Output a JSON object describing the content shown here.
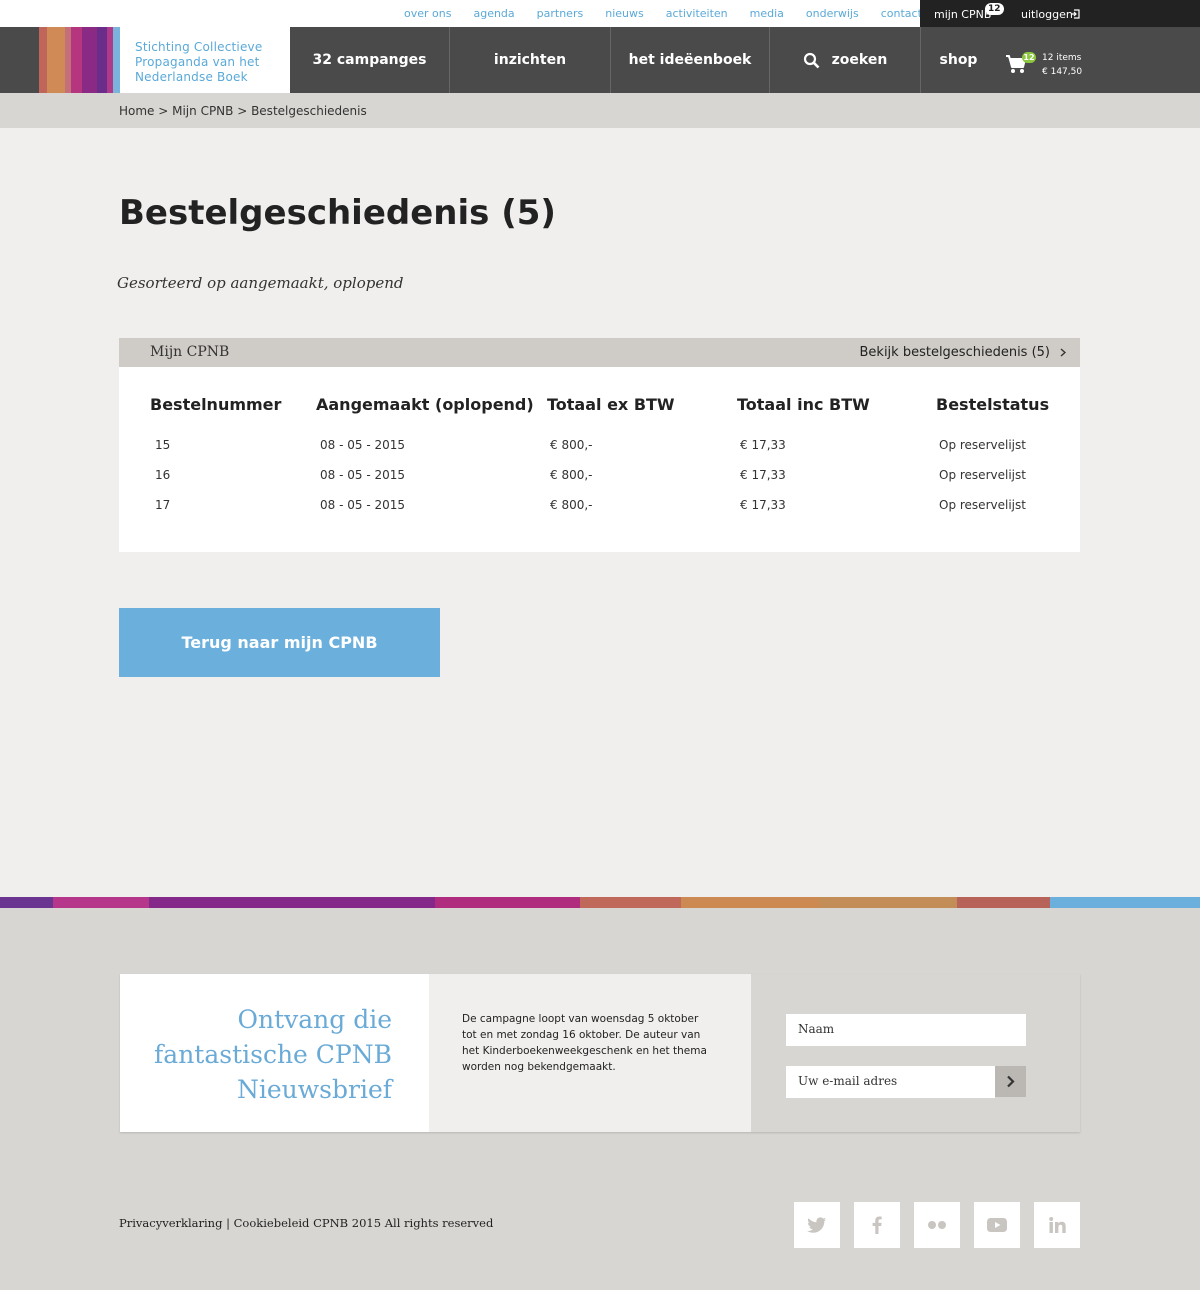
{
  "top_links": [
    "over ons",
    "agenda",
    "partners",
    "nieuws",
    "activiteiten",
    "media",
    "onderwijs",
    "contact"
  ],
  "user": {
    "label": "mijn CPNB",
    "badge": "12",
    "logout": "uitloggen"
  },
  "logo": {
    "line1": "Stichting Collectieve",
    "line2": "Propaganda van het",
    "line3": "Nederlandse Boek"
  },
  "nav": {
    "campaigns": "32 campanges",
    "insights": "inzichten",
    "ideas": "het ideëenboek",
    "search": "zoeken",
    "shop": "shop"
  },
  "cart": {
    "badge": "12",
    "items": "12 items",
    "total": "€ 147,50"
  },
  "breadcrumb": "Home > Mijn CPNB > Bestelgeschiedenis",
  "page": {
    "title": "Bestelgeschiedenis (5)",
    "sort_note": "Gesorteerd op aangemaakt, oplopend"
  },
  "panel": {
    "title": "Mijn CPNB",
    "link": "Bekijk bestelgeschiedenis (5)"
  },
  "table": {
    "headers": [
      "Bestelnummer",
      "Aangemaakt (oplopend)",
      "Totaal ex BTW",
      "Totaal inc BTW",
      "Bestelstatus"
    ],
    "rows": [
      [
        "15",
        "08 - 05 - 2015",
        "€ 800,-",
        "€ 17,33",
        "Op reservelijst"
      ],
      [
        "16",
        "08 - 05 - 2015",
        "€ 800,-",
        "€ 17,33",
        "Op reservelijst"
      ],
      [
        "17",
        "08 - 05 - 2015",
        "€ 800,-",
        "€ 17,33",
        "Op reservelijst"
      ]
    ]
  },
  "back_button": "Terug naar mijn CPNB",
  "newsletter": {
    "title_l1": "Ontvang die",
    "title_l2": "fantastische CPNB",
    "title_l3": "Nieuwsbrief",
    "text": "De campagne loopt van woensdag 5 oktober tot en met zondag 16 oktober. De auteur van het Kinderboekenweekgeschenk en het thema worden nog bekendgemaakt.",
    "name_placeholder": "Naam",
    "email_placeholder": "Uw e-mail adres"
  },
  "footer": {
    "legal": "Privacyverklaring | Cookiebeleid  CPNB 2015 All rights reserved"
  },
  "social_icons": [
    "twitter-icon",
    "facebook-icon",
    "flickr-icon",
    "youtube-icon",
    "linkedin-icon"
  ],
  "colors": {
    "accent_blue": "#6bb0dc",
    "nav_bg": "#4a4a4a",
    "link_blue": "#5aa9d8"
  }
}
